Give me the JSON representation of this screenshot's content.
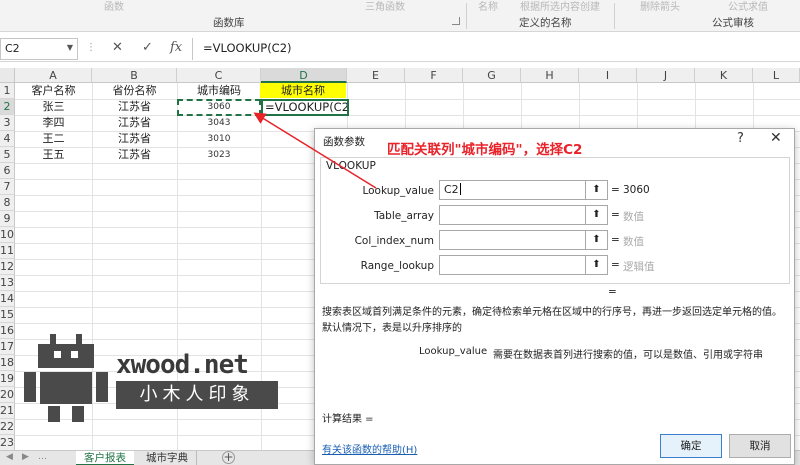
{
  "ribbon": {
    "faded_items": [
      "函数",
      "三角函数",
      "名称",
      "根据所选内容创建",
      "删除箭头",
      "公式求值"
    ],
    "groups": [
      "函数库",
      "定义的名称",
      "公式审核"
    ]
  },
  "formula_bar": {
    "name_box": "C2",
    "formula": "=VLOOKUP(C2)"
  },
  "sheet": {
    "columns": [
      "A",
      "B",
      "C",
      "D",
      "E",
      "F",
      "G",
      "H",
      "I",
      "J",
      "K",
      "L"
    ],
    "rows": [
      "1",
      "2",
      "3",
      "4",
      "5",
      "6",
      "7",
      "8",
      "9",
      "10",
      "11",
      "12",
      "13",
      "14",
      "15",
      "16",
      "17",
      "18",
      "19",
      "20",
      "21",
      "22",
      "23"
    ],
    "active_col": "D",
    "active_row": "2",
    "headers": [
      "客户名称",
      "省份名称",
      "城市编码",
      "城市名称"
    ],
    "data": [
      {
        "name": "张三",
        "province": "江苏省",
        "code": "3060"
      },
      {
        "name": "李四",
        "province": "江苏省",
        "code": "3043"
      },
      {
        "name": "王二",
        "province": "江苏省",
        "code": "3010"
      },
      {
        "name": "王五",
        "province": "江苏省",
        "code": "3023"
      }
    ],
    "editing_cell": "=VLOOKUP(C2)"
  },
  "tabs": {
    "sheets": [
      "客户报表",
      "城市字典"
    ],
    "active": "客户报表",
    "nav_prev": "◀",
    "nav_next": "▶",
    "add": "+"
  },
  "watermark": {
    "text": "xwood.net",
    "sub": "小木人印象"
  },
  "dialog": {
    "title": "函数参数",
    "help": "?",
    "close": "✕",
    "annotation": "匹配关联列\"城市编码\"，选择C2",
    "function": "VLOOKUP",
    "args": [
      {
        "label": "Lookup_value",
        "value": "C2",
        "result": "3060",
        "placeholder": false
      },
      {
        "label": "Table_array",
        "value": "",
        "result": "数值",
        "placeholder": true
      },
      {
        "label": "Col_index_num",
        "value": "",
        "result": "数值",
        "placeholder": true
      },
      {
        "label": "Range_lookup",
        "value": "",
        "result": "逻辑值",
        "placeholder": true
      }
    ],
    "equals": "=",
    "description": "搜索表区域首列满足条件的元素，确定待检索单元格在区域中的行序号，再进一步返回选定单元格的值。默认情况下，表是以升序排序的",
    "arg_desc_name": "Lookup_value",
    "arg_desc_text": "需要在数据表首列进行搜索的值，可以是数值、引用或字符串",
    "calc_result": "计算结果 =",
    "help_link": "有关该函数的帮助(H)",
    "ok": "确定",
    "cancel": "取消"
  },
  "colors": {
    "excel_green": "#217346",
    "header_yellow": "#ffff00",
    "annotation_red": "#e8232a",
    "link_blue": "#1a5fb4"
  }
}
